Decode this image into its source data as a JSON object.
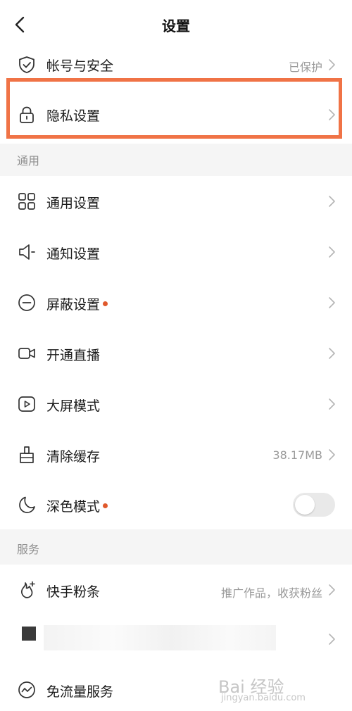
{
  "header": {
    "title": "设置"
  },
  "rows": {
    "account": {
      "label": "帐号与安全",
      "value": "已保护"
    },
    "privacy": {
      "label": "隐私设置"
    },
    "general": {
      "label": "通用设置"
    },
    "notify": {
      "label": "通知设置"
    },
    "block": {
      "label": "屏蔽设置"
    },
    "live": {
      "label": "开通直播"
    },
    "bigscreen": {
      "label": "大屏模式"
    },
    "cache": {
      "label": "清除缓存",
      "value": "38.17MB"
    },
    "dark": {
      "label": "深色模式",
      "enabled": false
    },
    "fans": {
      "label": "快手粉条",
      "value": "推广作品，收获粉丝"
    },
    "traffic": {
      "label": "免流量服务"
    }
  },
  "sections": {
    "general": "通用",
    "service": "服务"
  },
  "watermark": {
    "text": "Bai 经验",
    "sub": "jingyan.baidu.com"
  },
  "colors": {
    "highlight": "#f07346",
    "dot": "#e0592c",
    "section_bg": "#f5f5f5"
  }
}
